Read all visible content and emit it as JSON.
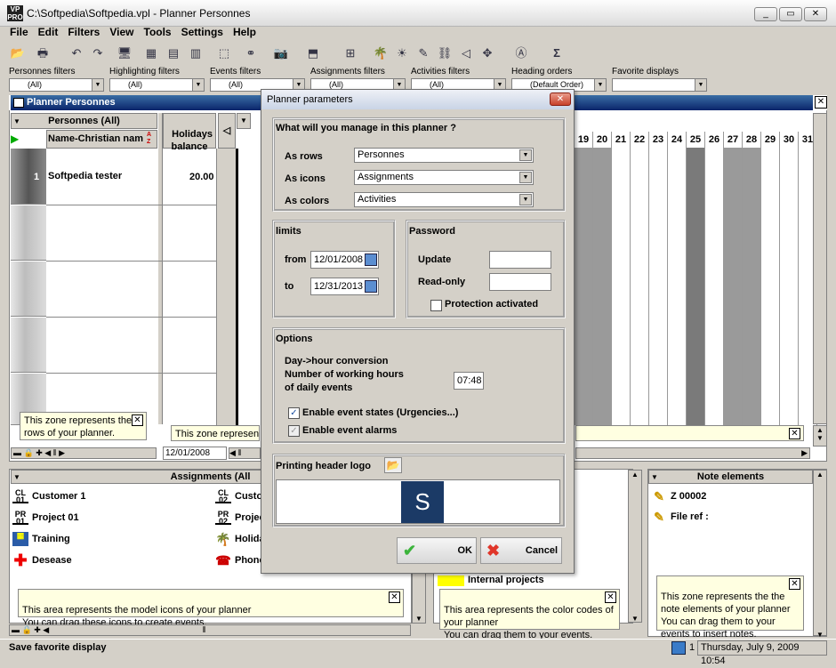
{
  "window": {
    "title": "C:\\Softpedia\\Softpedia.vpl - Planner Personnes"
  },
  "menu": [
    "File",
    "Edit",
    "Filters",
    "View",
    "Tools",
    "Settings",
    "Help"
  ],
  "filters": [
    {
      "label": "Personnes filters",
      "value": "(All)"
    },
    {
      "label": "Highlighting filters",
      "value": "(All)"
    },
    {
      "label": "Events filters",
      "value": "(All)"
    },
    {
      "label": "Assignments filters",
      "value": "(All)"
    },
    {
      "label": "Activities filters",
      "value": "(All)"
    },
    {
      "label": "Heading orders",
      "value": "(Default Order)"
    },
    {
      "label": "Favorite displays",
      "value": ""
    }
  ],
  "planner": {
    "title": "Planner Personnes",
    "rows_header": "Personnes (All)",
    "name_col": "Name-Christian nam",
    "sort_az": "A\nZ",
    "holidays_header": "Holidays\nbalance",
    "row_number": "1",
    "row_name": "Softpedia tester",
    "row_balance": "20.00",
    "days": [
      "19",
      "20",
      "21",
      "22",
      "23",
      "24",
      "25",
      "26",
      "27",
      "28",
      "29",
      "30",
      "31"
    ],
    "rows_note": "This zone represents the rows of your planner.",
    "cells_note": "This zone represent",
    "date_field": "12/01/2008"
  },
  "dialog": {
    "title": "Planner parameters",
    "question": "What will you manage in this planner ?",
    "rows_label": "As rows",
    "rows_value": "Personnes",
    "icons_label": "As icons",
    "icons_value": "Assignments",
    "colors_label": "As colors",
    "colors_value": "Activities",
    "limits_title": "limits",
    "from_label": "from",
    "from_value": "12/01/2008",
    "to_label": "to",
    "to_value": "12/31/2013",
    "password_title": "Password",
    "update_label": "Update",
    "readonly_label": "Read-only",
    "protection_label": "Protection activated",
    "options_title": "Options",
    "conversion_line1": "Day->hour conversion",
    "conversion_line2": "Number of working hours",
    "conversion_line3": "of daily events",
    "hours_value": "07:48",
    "states_label": "Enable event states (Urgencies...)",
    "alarms_label": "Enable event alarms",
    "logo_title": "Printing header logo",
    "logo_letter": "S",
    "ok_label": "OK",
    "cancel_label": "Cancel"
  },
  "assignments": {
    "header": "Assignments (All",
    "items": [
      {
        "code": "CL\n01",
        "label": "Customer 1"
      },
      {
        "code": "PR\n01",
        "label": "Project 01"
      },
      {
        "code": "",
        "label": "Training"
      },
      {
        "code": "",
        "label": "Desease"
      }
    ],
    "items2": [
      {
        "code": "CL\n02",
        "label": "Custo"
      },
      {
        "code": "PR\n02",
        "label": "Projec"
      },
      {
        "code": "",
        "label": "Holida"
      },
      {
        "code": "",
        "label": "Phone"
      }
    ],
    "note": "This area represents the model icons of your planner\nYou can drag these icons to create events."
  },
  "colors": {
    "item": "Internal projects",
    "note": "This area represents the color codes of your planner\nYou can drag them to your events."
  },
  "notes_panel": {
    "header": "Note elements",
    "items": [
      "Z 00002",
      "File ref :"
    ],
    "note": "This zone represents the the note elements of your planner\nYou can drag them to your events to insert notes."
  },
  "status": {
    "left": "Save favorite display",
    "count": "1",
    "datetime": "Thursday, July 9, 2009 10:54"
  },
  "colors_theme": {
    "accent": "#0a246a",
    "yellow_note": "#ffffe1",
    "logo_bg": "#1b3a66"
  }
}
